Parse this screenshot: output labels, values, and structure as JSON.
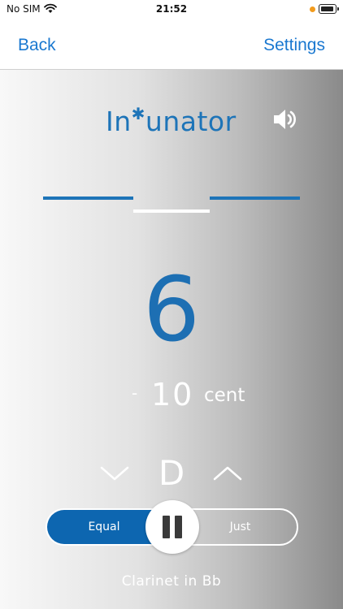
{
  "status_bar": {
    "carrier": "No SIM",
    "time": "21:52",
    "indicator_color": "#f29b1d"
  },
  "nav": {
    "back_label": "Back",
    "settings_label": "Settings",
    "accent_color": "#1a78d0"
  },
  "tuner": {
    "logo_text_prefix": "In",
    "logo_text_suffix": "unator",
    "logo_mark": "✱",
    "sound_icon": "speaker-icon",
    "reading_number": "6",
    "cent_sign": "-",
    "cent_value": "10",
    "cent_unit": "cent",
    "note": "D",
    "temperament": {
      "options": [
        "Equal",
        "Just"
      ],
      "selected": "Equal"
    },
    "instrument": "Clarinet in Bb",
    "brand_color": "#1d74b8"
  }
}
